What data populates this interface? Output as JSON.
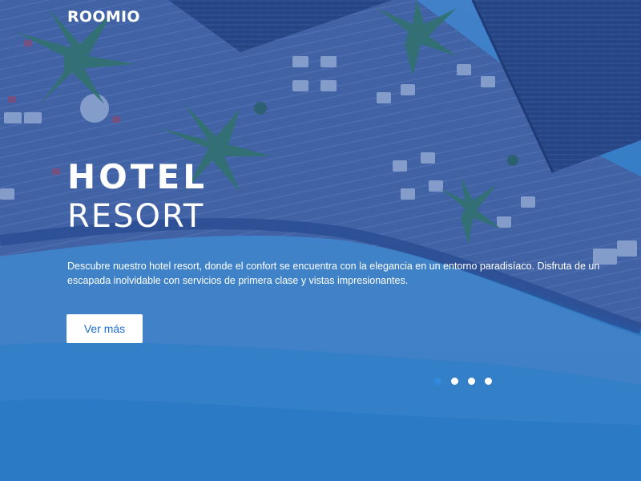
{
  "brand": {
    "logo_text": "ROOMIO"
  },
  "hero": {
    "title_line1": "HOTEL",
    "title_line2": "RESORT",
    "description": "Descubre nuestro hotel resort, donde el confort se encuentra con la elegancia en un entorno paradisíaco. Disfruta de un escapada inolvidable con servicios de primera clase y vistas impresionantes.",
    "cta_label": "Ver más",
    "background": "aerial view of resort deck, palm trees and turquoise beach with blue overlay"
  },
  "carousel": {
    "total_slides": 4,
    "active_index": 0
  },
  "colors": {
    "overlay": "#1f4ea3",
    "cta_text": "#1f6fd1",
    "active_dot": "#2f8ae0",
    "text": "#ffffff"
  }
}
